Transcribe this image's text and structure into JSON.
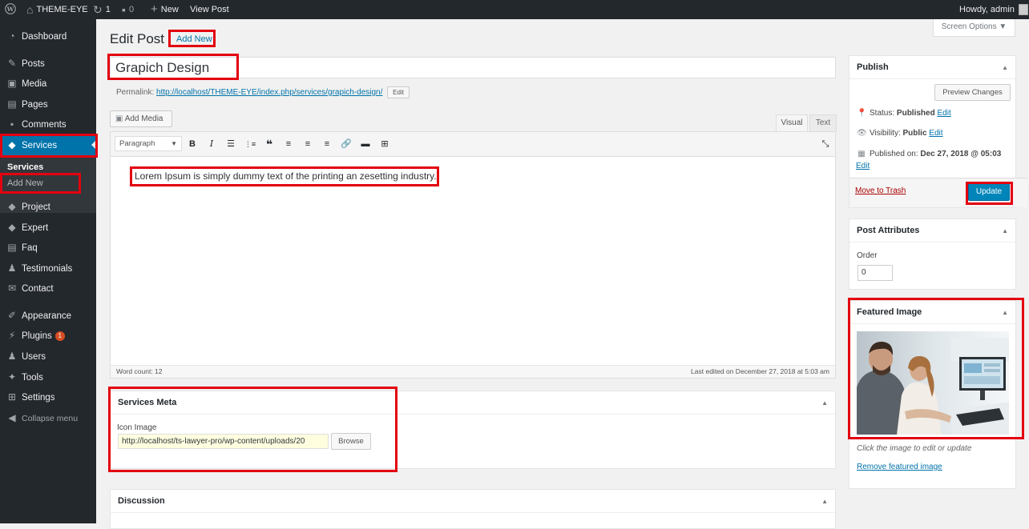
{
  "admin_bar": {
    "site_name": "THEME-EYE",
    "updates_count": "1",
    "comments_count": "0",
    "new_label": "New",
    "view_post_label": "View Post",
    "howdy": "Howdy, admin"
  },
  "sidebar": {
    "dashboard": "Dashboard",
    "posts": "Posts",
    "media": "Media",
    "pages": "Pages",
    "comments": "Comments",
    "services": "Services",
    "sub_services": "Services",
    "sub_add_new": "Add New",
    "project": "Project",
    "expert": "Expert",
    "faq": "Faq",
    "testimonials": "Testimonials",
    "contact": "Contact",
    "appearance": "Appearance",
    "plugins": "Plugins",
    "plugins_badge": "1",
    "users": "Users",
    "tools": "Tools",
    "settings": "Settings",
    "collapse": "Collapse menu"
  },
  "header": {
    "title": "Edit Post",
    "add_new": "Add New",
    "screen_options": "Screen Options"
  },
  "post": {
    "title": "Grapich Design",
    "permalink_label": "Permalink:",
    "permalink_url": "http://localhost/THEME-EYE/index.php/services/grapich-design/",
    "permalink_edit": "Edit",
    "add_media": "Add Media",
    "tab_visual": "Visual",
    "tab_text": "Text",
    "format": "Paragraph",
    "content": "Lorem Ipsum is simply dummy text of the printing an zesetting industry.",
    "word_count": "Word count: 12",
    "last_edited": "Last edited on December 27, 2018 at 5:03 am"
  },
  "services_meta": {
    "title": "Services Meta",
    "icon_label": "Icon Image",
    "icon_value": "http://localhost/ts-lawyer-pro/wp-content/uploads/20",
    "browse": "Browse"
  },
  "discussion": {
    "title": "Discussion"
  },
  "publish": {
    "title": "Publish",
    "preview": "Preview Changes",
    "status_label": "Status:",
    "status_value": "Published",
    "visibility_label": "Visibility:",
    "visibility_value": "Public",
    "published_on_label": "Published on:",
    "published_on_value": "Dec 27, 2018 @ 05:03",
    "edit": "Edit",
    "trash": "Move to Trash",
    "update": "Update"
  },
  "post_attributes": {
    "title": "Post Attributes",
    "order_label": "Order",
    "order_value": "0"
  },
  "featured_image": {
    "title": "Featured Image",
    "hint": "Click the image to edit or update",
    "remove": "Remove featured image"
  },
  "colors": {
    "accent": "#0073aa",
    "highlight": "#e3000f",
    "adminbar": "#23282d"
  }
}
